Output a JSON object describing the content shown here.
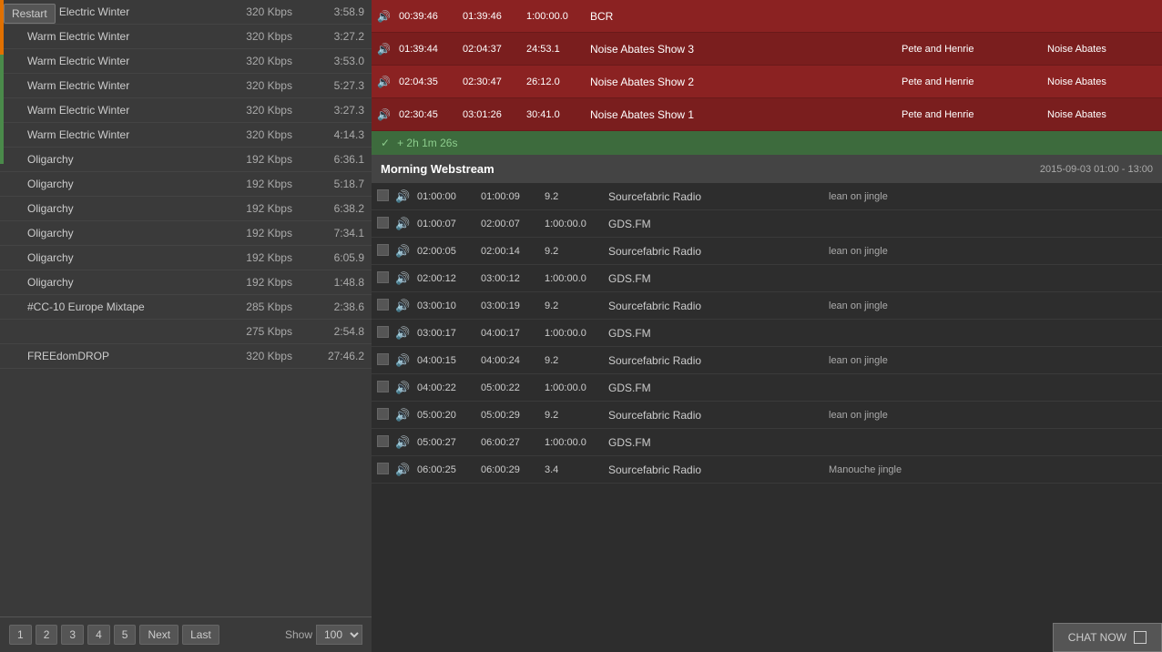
{
  "leftPanel": {
    "restartBtn": "Restart",
    "rows": [
      {
        "name": "Warm Electric Winter",
        "bitrate": "320 Kbps",
        "duration": "3:58.9"
      },
      {
        "name": "Warm Electric Winter",
        "bitrate": "320 Kbps",
        "duration": "3:27.2"
      },
      {
        "name": "Warm Electric Winter",
        "bitrate": "320 Kbps",
        "duration": "3:53.0"
      },
      {
        "name": "Warm Electric Winter",
        "bitrate": "320 Kbps",
        "duration": "5:27.3"
      },
      {
        "name": "Warm Electric Winter",
        "bitrate": "320 Kbps",
        "duration": "3:27.3"
      },
      {
        "name": "Warm Electric Winter",
        "bitrate": "320 Kbps",
        "duration": "4:14.3"
      },
      {
        "name": "Oligarchy",
        "bitrate": "192 Kbps",
        "duration": "6:36.1"
      },
      {
        "name": "Oligarchy",
        "bitrate": "192 Kbps",
        "duration": "5:18.7"
      },
      {
        "name": "Oligarchy",
        "bitrate": "192 Kbps",
        "duration": "6:38.2"
      },
      {
        "name": "Oligarchy",
        "bitrate": "192 Kbps",
        "duration": "7:34.1"
      },
      {
        "name": "Oligarchy",
        "bitrate": "192 Kbps",
        "duration": "6:05.9"
      },
      {
        "name": "Oligarchy",
        "bitrate": "192 Kbps",
        "duration": "1:48.8"
      },
      {
        "name": "#CC-10 Europe Mixtape",
        "bitrate": "285 Kbps",
        "duration": "2:38.6"
      },
      {
        "name": "",
        "bitrate": "275 Kbps",
        "duration": "2:54.8"
      },
      {
        "name": "FREEdomDROP",
        "bitrate": "320 Kbps",
        "duration": "27:46.2"
      }
    ],
    "pagination": {
      "pages": [
        "1",
        "2",
        "3",
        "4",
        "5"
      ],
      "nextLabel": "Next",
      "lastLabel": "Last",
      "showLabel": "Show",
      "showValue": "100"
    }
  },
  "rightPanel": {
    "showRows": [
      {
        "start": "00:39:46",
        "end": "01:39:46",
        "duration": "1:00:00.0",
        "name": "BCR",
        "creator": "",
        "show": ""
      },
      {
        "start": "01:39:44",
        "end": "02:04:37",
        "duration": "24:53.1",
        "name": "Noise Abates Show 3",
        "creator": "Pete and Henrie",
        "show": "Noise Abates"
      },
      {
        "start": "02:04:35",
        "end": "02:30:47",
        "duration": "26:12.0",
        "name": "Noise Abates Show 2",
        "creator": "Pete and Henrie",
        "show": "Noise Abates"
      },
      {
        "start": "02:30:45",
        "end": "03:01:26",
        "duration": "30:41.0",
        "name": "Noise Abates Show 1",
        "creator": "Pete and Henrie",
        "show": "Noise Abates"
      }
    ],
    "timeAddition": "+ 2h 1m 26s",
    "morningSection": {
      "title": "Morning Webstream",
      "dateRange": "2015-09-03 01:00 - 13:00"
    },
    "dataRows": [
      {
        "start": "01:00:00",
        "end": "01:00:09",
        "duration": "9.2",
        "name": "Sourcefabric Radio",
        "creator": "lean on jingle",
        "show": ""
      },
      {
        "start": "01:00:07",
        "end": "02:00:07",
        "duration": "1:00:00.0",
        "name": "GDS.FM",
        "creator": "",
        "show": ""
      },
      {
        "start": "02:00:05",
        "end": "02:00:14",
        "duration": "9.2",
        "name": "Sourcefabric Radio",
        "creator": "lean on jingle",
        "show": ""
      },
      {
        "start": "02:00:12",
        "end": "03:00:12",
        "duration": "1:00:00.0",
        "name": "GDS.FM",
        "creator": "",
        "show": ""
      },
      {
        "start": "03:00:10",
        "end": "03:00:19",
        "duration": "9.2",
        "name": "Sourcefabric Radio",
        "creator": "lean on jingle",
        "show": ""
      },
      {
        "start": "03:00:17",
        "end": "04:00:17",
        "duration": "1:00:00.0",
        "name": "GDS.FM",
        "creator": "",
        "show": ""
      },
      {
        "start": "04:00:15",
        "end": "04:00:24",
        "duration": "9.2",
        "name": "Sourcefabric Radio",
        "creator": "lean on jingle",
        "show": ""
      },
      {
        "start": "04:00:22",
        "end": "05:00:22",
        "duration": "1:00:00.0",
        "name": "GDS.FM",
        "creator": "",
        "show": ""
      },
      {
        "start": "05:00:20",
        "end": "05:00:29",
        "duration": "9.2",
        "name": "Sourcefabric Radio",
        "creator": "lean on jingle",
        "show": ""
      },
      {
        "start": "05:00:27",
        "end": "06:00:27",
        "duration": "1:00:00.0",
        "name": "GDS.FM",
        "creator": "",
        "show": ""
      },
      {
        "start": "06:00:25",
        "end": "06:00:29",
        "duration": "3.4",
        "name": "Sourcefabric Radio",
        "creator": "Manouche jingle",
        "show": ""
      }
    ],
    "chatNow": "CHAT NOW"
  }
}
